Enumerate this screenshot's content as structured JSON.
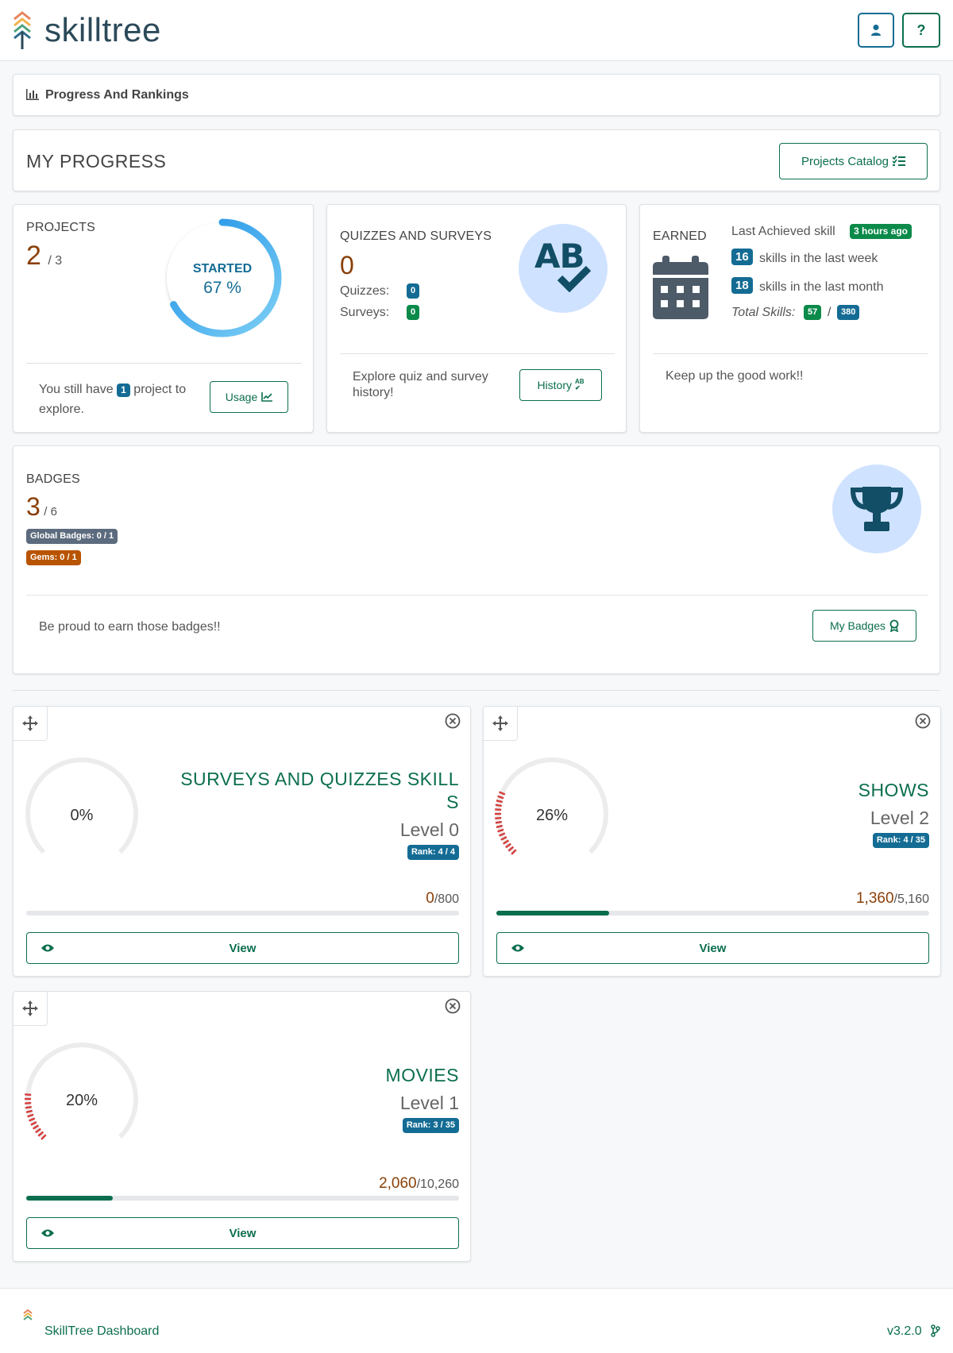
{
  "header": {
    "app_name": "skilltree",
    "user_button": "user-icon",
    "help_button": "?"
  },
  "breadcrumb": {
    "label": "Progress And Rankings"
  },
  "my_progress": {
    "title": "MY PROGRESS",
    "catalog_button": "Projects Catalog"
  },
  "projects_card": {
    "caption": "PROJECTS",
    "count": "2",
    "total": "/ 3",
    "gauge_label": "STARTED",
    "gauge_value": "67 %",
    "gauge_percent": 67,
    "footer_pre": "You still have",
    "footer_badge": "1",
    "footer_post": "project to",
    "footer_post2": "explore.",
    "usage_button": "Usage"
  },
  "quizzes_card": {
    "caption": "QUIZZES AND SURVEYS",
    "count": "0",
    "quizzes_label": "Quizzes:",
    "quizzes_value": "0",
    "surveys_label": "Surveys:",
    "surveys_value": "0",
    "footer": "Explore quiz and survey history!",
    "history_button": "History"
  },
  "earned_card": {
    "caption": "EARNED",
    "last_label": "Last Achieved skill",
    "last_badge": "3 hours ago",
    "week_count": "16",
    "week_label": "skills in the last week",
    "month_count": "18",
    "month_label": "skills in the last month",
    "total_label": "Total Skills:",
    "total_achieved": "57",
    "total_sep": "/",
    "total_all": "380",
    "footer": "Keep up the good work!!"
  },
  "badges_card": {
    "caption": "BADGES",
    "count": "3",
    "total": "/ 6",
    "global_badge": "Global Badges: 0 / 1",
    "gems_badge": "Gems: 0 / 1",
    "footer": "Be proud to earn those badges!!",
    "my_badges_button": "My Badges"
  },
  "projects": [
    {
      "name_line1": "SURVEYS AND QUIZZES SKILL",
      "name_line2": "S",
      "percent_label": "0%",
      "percent": 0,
      "level": "Level 0",
      "rank": "Rank: 4 / 4",
      "points": "0",
      "total_points": "/800",
      "progress": 0,
      "view": "View"
    },
    {
      "name_line1": "SHOWS",
      "name_line2": "",
      "percent_label": "26%",
      "percent": 26,
      "level": "Level 2",
      "rank": "Rank: 4 / 35",
      "points": "1,360",
      "total_points": "/5,160",
      "progress": 26,
      "view": "View"
    },
    {
      "name_line1": "MOVIES",
      "name_line2": "",
      "percent_label": "20%",
      "percent": 20,
      "level": "Level 1",
      "rank": "Rank: 3 / 35",
      "points": "2,060",
      "total_points": "/10,260",
      "progress": 20,
      "view": "View"
    }
  ],
  "footer": {
    "label": "SkillTree Dashboard",
    "version": "v3.2.0"
  },
  "colors": {
    "primary": "#0b6e4f",
    "accent_blue": "#146c94",
    "orange": "#8a3f07",
    "red_ticks": "#d63a3a"
  }
}
